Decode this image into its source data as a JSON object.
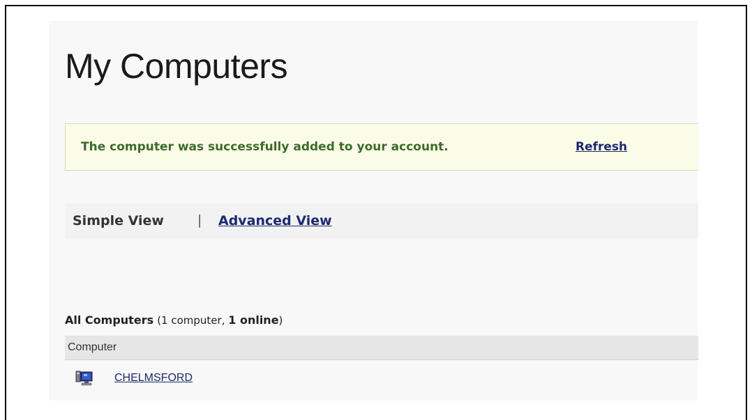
{
  "page": {
    "title": "My Computers"
  },
  "notice": {
    "message": "The computer was successfully added to your account.",
    "refresh_label": "Refresh"
  },
  "views": {
    "simple_label": "Simple View",
    "separator": "|",
    "advanced_label": "Advanced View",
    "active": "Simple View"
  },
  "computers": {
    "heading_label": "All Computers",
    "paren_open": "(",
    "count_text": "1 computer, ",
    "online_text": "1 online",
    "paren_close": ")",
    "column_header": "Computer",
    "rows": [
      {
        "name": "CHELMSFORD",
        "icon": "computer-online-icon",
        "status": "online"
      }
    ]
  },
  "colors": {
    "notice_text": "#3d6b2b",
    "notice_background": "#fbfce8",
    "link": "#1d2a6e",
    "header_background": "#e6e6e6"
  }
}
